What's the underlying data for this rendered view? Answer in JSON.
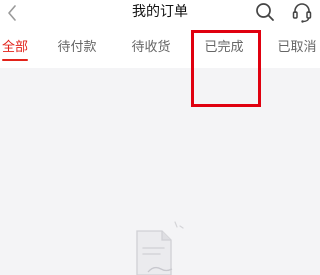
{
  "header": {
    "title": "我的订单"
  },
  "icons": {
    "back": "chevron-left-icon",
    "search": "search-icon",
    "service": "customer-service-icon",
    "empty": "empty-document-icon"
  },
  "tabs": [
    {
      "label": "全部",
      "active": true
    },
    {
      "label": "待付款",
      "active": false
    },
    {
      "label": "待收货",
      "active": false
    },
    {
      "label": "已完成",
      "active": false
    },
    {
      "label": "已取消",
      "active": false
    }
  ],
  "colors": {
    "accent": "#e2231a",
    "highlight": "#e0000f",
    "background": "#f4f4f6"
  }
}
